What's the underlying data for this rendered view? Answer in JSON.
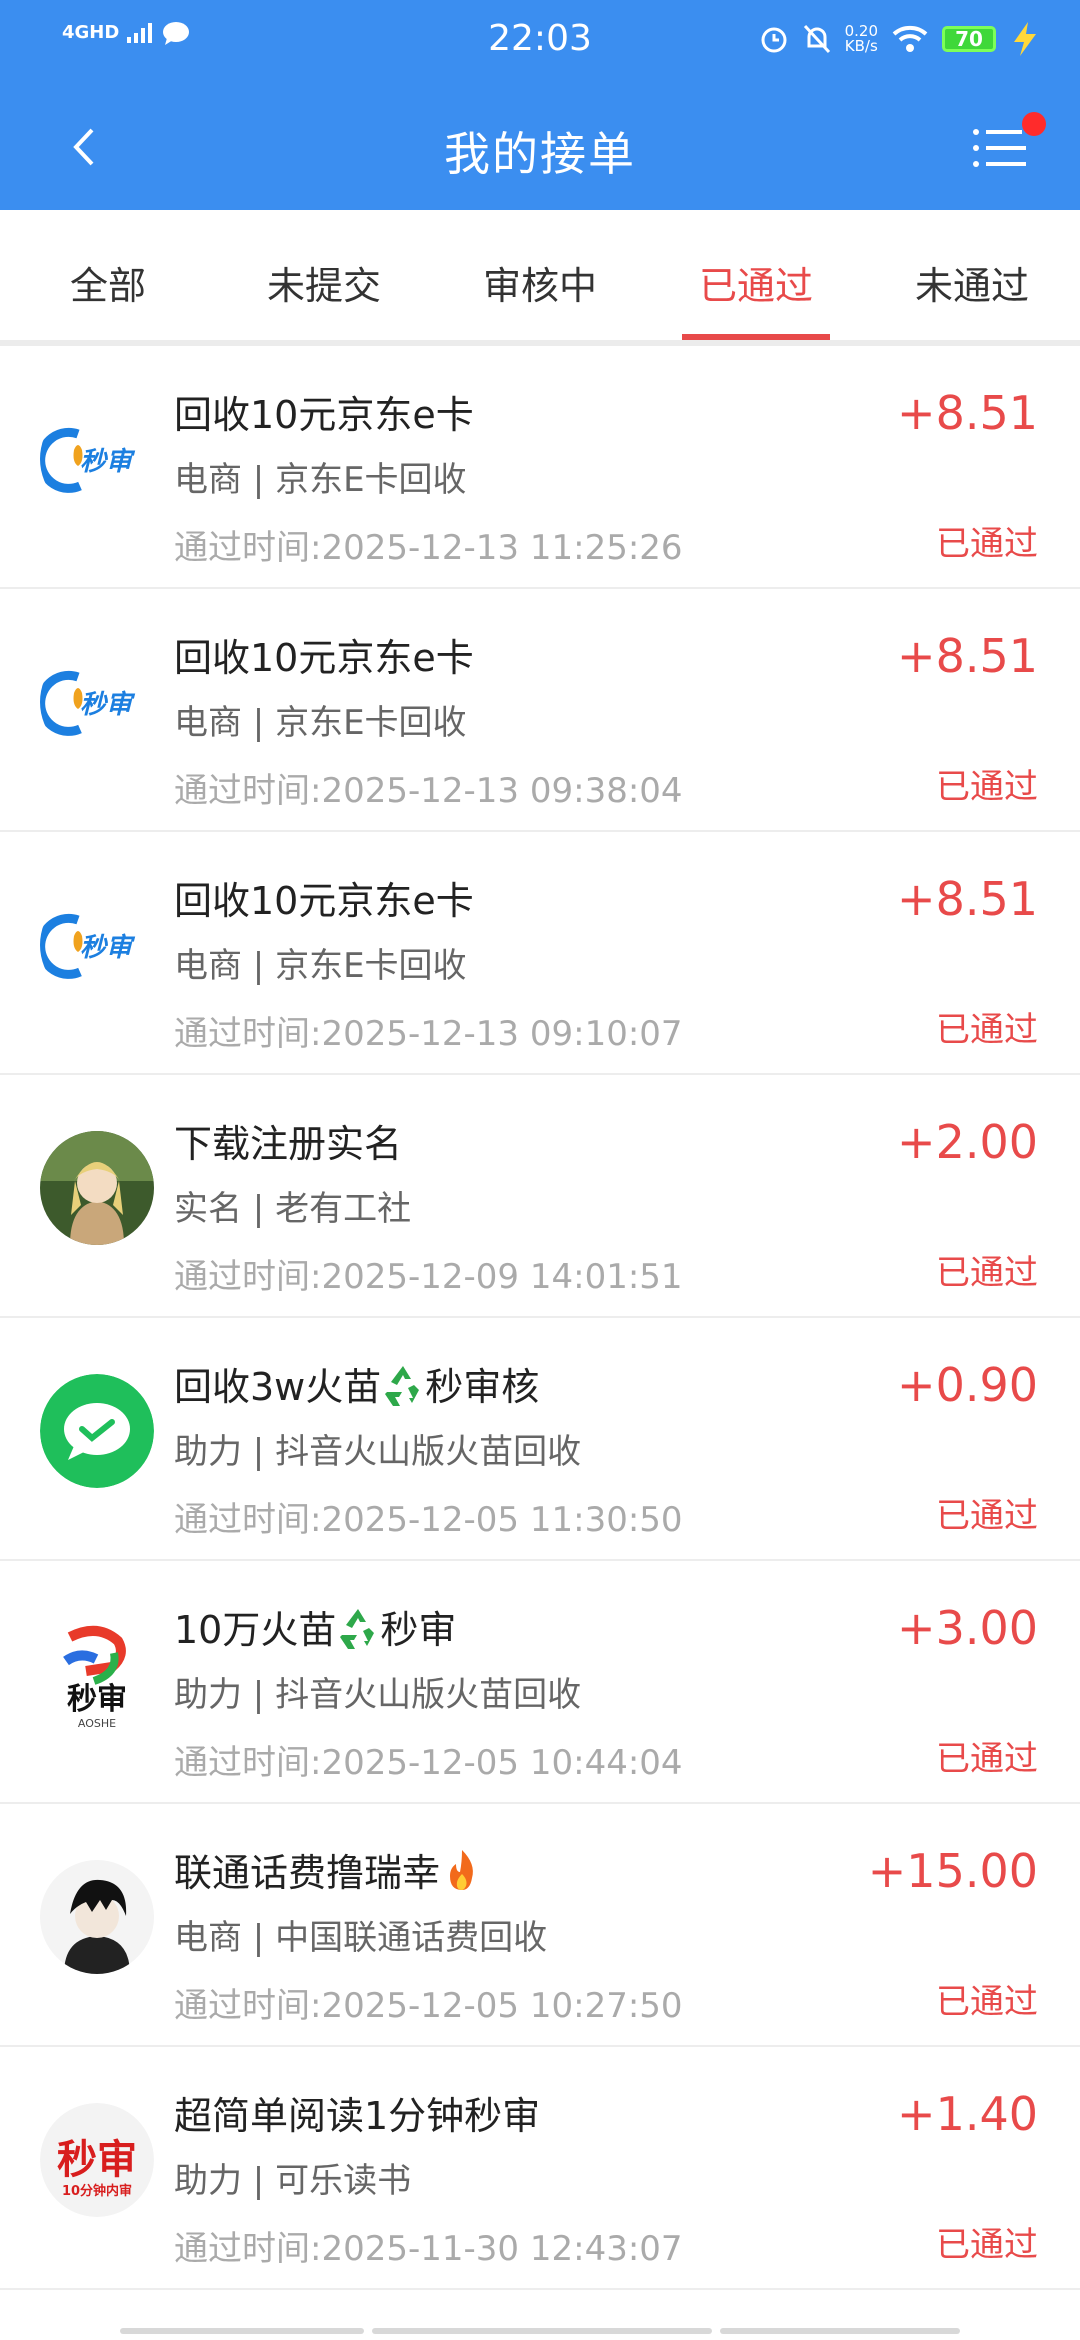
{
  "status_bar": {
    "network": "4GHD",
    "time": "22:03",
    "speed_value": "0.20",
    "speed_unit": "KB/s",
    "battery": "70"
  },
  "header": {
    "title": "我的接单"
  },
  "tabs": [
    {
      "label": "全部"
    },
    {
      "label": "未提交"
    },
    {
      "label": "审核中"
    },
    {
      "label": "已通过",
      "active": true
    },
    {
      "label": "未通过"
    }
  ],
  "orders": [
    {
      "title": "回收10元京东e卡",
      "category": "电商 | 京东E卡回收",
      "time": "通过时间:2025-12-13 11:25:26",
      "amount": "+8.51",
      "status": "已通过",
      "logo": "miaoshen-logo"
    },
    {
      "title": "回收10元京东e卡",
      "category": "电商 | 京东E卡回收",
      "time": "通过时间:2025-12-13 09:38:04",
      "amount": "+8.51",
      "status": "已通过",
      "logo": "miaoshen-logo"
    },
    {
      "title": "回收10元京东e卡",
      "category": "电商 | 京东E卡回收",
      "time": "通过时间:2025-12-13 09:10:07",
      "amount": "+8.51",
      "status": "已通过",
      "logo": "miaoshen-logo"
    },
    {
      "title": "下载注册实名",
      "category": "实名 | 老有工社",
      "time": "通过时间:2025-12-09 14:01:51",
      "amount": "+2.00",
      "status": "已通过",
      "logo": "anime-avatar"
    },
    {
      "title": "回收3w火苗",
      "title_suffix": "秒审核",
      "category": "助力 | 抖音火山版火苗回收",
      "time": "通过时间:2025-12-05 11:30:50",
      "amount": "+0.90",
      "status": "已通过",
      "logo": "green-check-logo",
      "emoji": "recycle-icon"
    },
    {
      "title": "10万火苗",
      "title_suffix": "秒审",
      "category": "助力 | 抖音火山版火苗回收",
      "time": "通过时间:2025-12-05 10:44:04",
      "amount": "+3.00",
      "status": "已通过",
      "logo": "miaoshen-9-logo",
      "emoji": "recycle-icon"
    },
    {
      "title": "联通话费撸瑞幸",
      "title_suffix": "",
      "category": "电商 | 中国联通话费回收",
      "time": "通过时间:2025-12-05 10:27:50",
      "amount": "+15.00",
      "status": "已通过",
      "logo": "dark-avatar",
      "emoji": "fire-icon"
    },
    {
      "title": "超简单阅读1分钟秒审",
      "category": "助力 | 可乐读书",
      "time": "通过时间:2025-11-30 12:43:07",
      "amount": "+1.40",
      "status": "已通过",
      "logo": "miaoshen-red-logo"
    }
  ],
  "logos": {
    "miaoshen_text": "秒审",
    "miaoshen_red_sub": "10分钟内审",
    "miaoshen_9_sub": "AOSHE"
  },
  "colors": {
    "accent_blue": "#3b8ef0",
    "accent_red": "#e84a4a"
  }
}
